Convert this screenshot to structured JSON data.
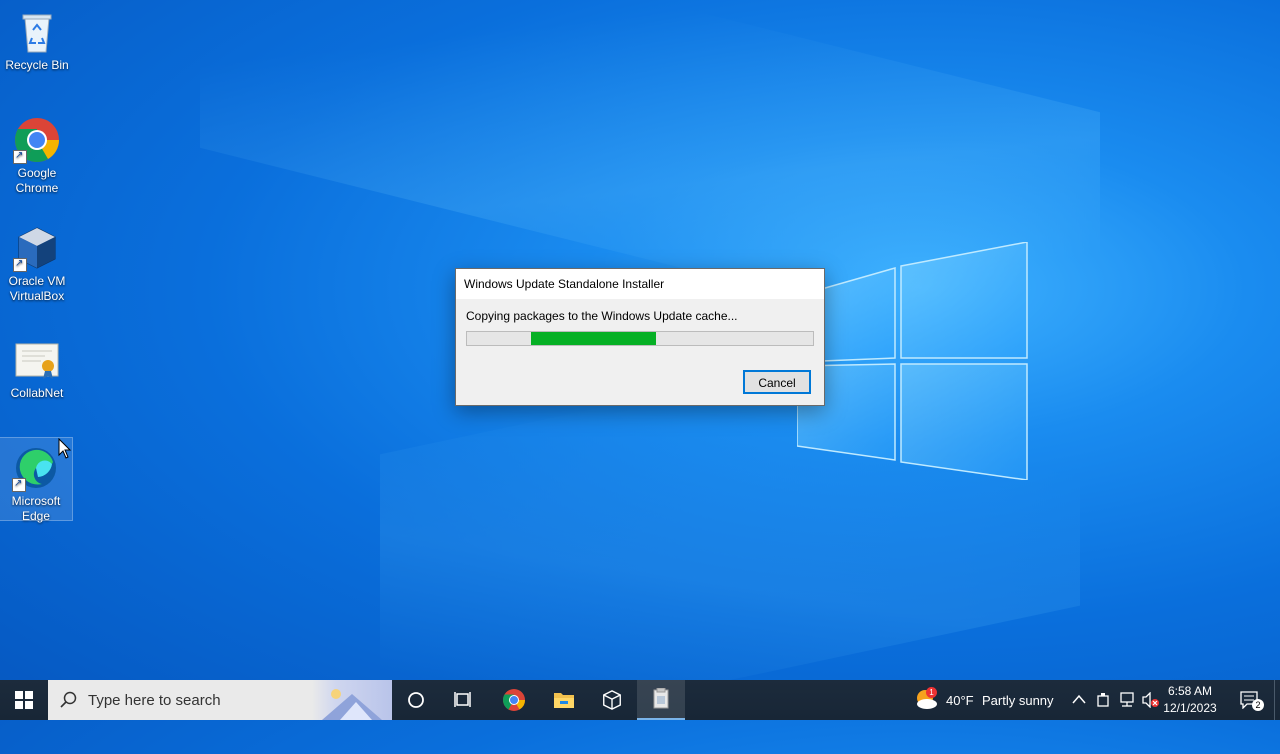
{
  "desktop": {
    "icons": [
      {
        "label_line1": "Recycle Bin",
        "label_line2": "",
        "icon": "recycle-bin-icon"
      },
      {
        "label_line1": "Google",
        "label_line2": "Chrome",
        "icon": "chrome-icon"
      },
      {
        "label_line1": "Oracle VM",
        "label_line2": "VirtualBox",
        "icon": "virtualbox-icon"
      },
      {
        "label_line1": "CollabNet",
        "label_line2": "",
        "icon": "certificate-icon"
      },
      {
        "label_line1": "Microsoft",
        "label_line2": "Edge",
        "icon": "edge-icon"
      }
    ]
  },
  "dialog": {
    "title": "Windows Update Standalone Installer",
    "message": "Copying packages to the Windows Update cache...",
    "progress_fraction": 0.36,
    "cancel_label": "Cancel"
  },
  "taskbar": {
    "search_placeholder": "Type here to search",
    "pinned": [
      "cortana-icon",
      "task-view-icon",
      "chrome-icon",
      "file-explorer-icon",
      "virtualbox-icon",
      "installer-icon"
    ],
    "weather": {
      "temp": "40°F",
      "condition": "Partly sunny",
      "badge": "1"
    },
    "clock": {
      "time": "6:58 AM",
      "date": "12/1/2023"
    },
    "notification_count": "2"
  },
  "colors": {
    "progress_fill": "#06b025",
    "button_border": "#0078d7",
    "taskbar_bg": "#1b2a3a"
  }
}
